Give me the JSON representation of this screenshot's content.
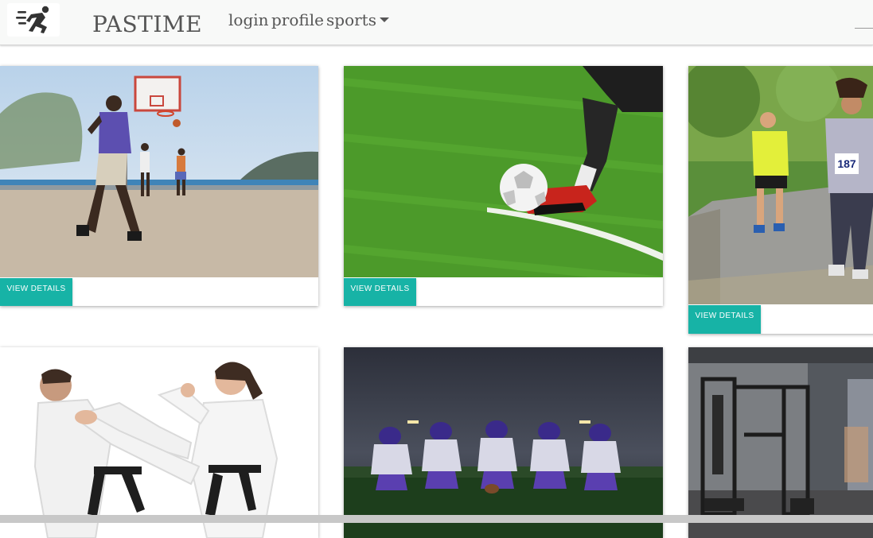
{
  "header": {
    "brand": "PASTIME",
    "logo_icon": "running-person-icon",
    "nav": [
      {
        "label": "login"
      },
      {
        "label": "profile"
      },
      {
        "label": "sports",
        "icon": "caret-down-icon"
      }
    ]
  },
  "cards": [
    {
      "subject": "basketball",
      "button_label": "VIEW DETAILS"
    },
    {
      "subject": "soccer",
      "button_label": "VIEW DETAILS"
    },
    {
      "subject": "running",
      "button_label": "VIEW DETAILS",
      "bib_number": "187"
    },
    {
      "subject": "karate"
    },
    {
      "subject": "american-football"
    },
    {
      "subject": "gym"
    }
  ],
  "colors": {
    "navbar_bg": "#f8f9f8",
    "button_bg": "#17b3a6",
    "button_text": "#ffffff",
    "nav_text": "#565656"
  }
}
